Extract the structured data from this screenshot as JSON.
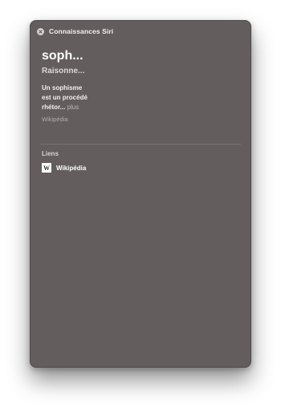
{
  "window": {
    "title": "Connaissances Siri",
    "close_icon": "close-circle-icon"
  },
  "article": {
    "title": "soph...",
    "subtitle": "Raisonne...",
    "description": "Un sophisme est un procédé rhétor...",
    "more_label": "plus",
    "source": "Wikipédia"
  },
  "links": {
    "section_title": "Liens",
    "items": [
      {
        "icon": "wikipedia-icon",
        "icon_glyph": "W",
        "label": "Wikipédia"
      }
    ]
  }
}
